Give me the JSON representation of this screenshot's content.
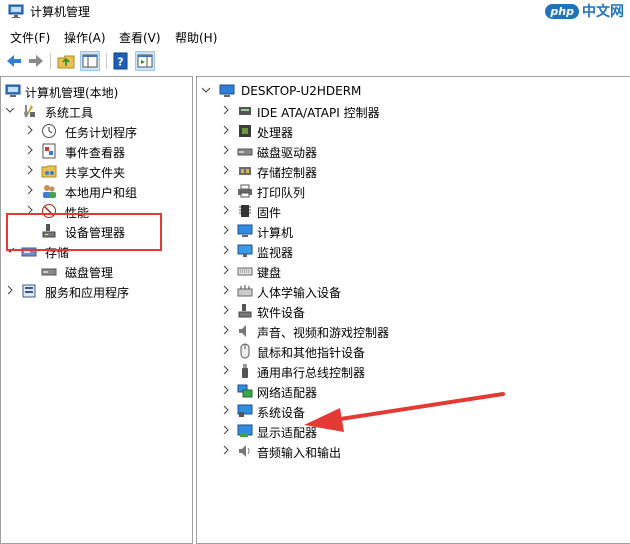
{
  "window": {
    "title": "计算机管理"
  },
  "watermark": {
    "brand": "php",
    "text": "中文网"
  },
  "menu": [
    "文件(F)",
    "操作(A)",
    "查看(V)",
    "帮助(H)"
  ],
  "left_tree": [
    {
      "label": "计算机管理(本地)",
      "icon": "computer-management-icon"
    },
    {
      "label": "系统工具",
      "icon": "system-tools-icon"
    },
    {
      "label": "任务计划程序",
      "icon": "clock-icon"
    },
    {
      "label": "事件查看器",
      "icon": "event-viewer-icon"
    },
    {
      "label": "共享文件夹",
      "icon": "shared-folder-icon"
    },
    {
      "label": "本地用户和组",
      "icon": "users-icon"
    },
    {
      "label": "性能",
      "icon": "performance-icon"
    },
    {
      "label": "设备管理器",
      "icon": "device-manager-icon"
    },
    {
      "label": "存储",
      "icon": "storage-icon"
    },
    {
      "label": "磁盘管理",
      "icon": "disk-management-icon"
    },
    {
      "label": "服务和应用程序",
      "icon": "services-icon"
    }
  ],
  "device_tree": {
    "root": "DESKTOP-U2HDERM",
    "items": [
      {
        "label": "IDE ATA/ATAPI 控制器",
        "icon": "ide-controller-icon"
      },
      {
        "label": "处理器",
        "icon": "processor-icon"
      },
      {
        "label": "磁盘驱动器",
        "icon": "disk-drive-icon"
      },
      {
        "label": "存储控制器",
        "icon": "storage-controller-icon"
      },
      {
        "label": "打印队列",
        "icon": "printer-icon"
      },
      {
        "label": "固件",
        "icon": "firmware-icon"
      },
      {
        "label": "计算机",
        "icon": "computer-icon"
      },
      {
        "label": "监视器",
        "icon": "monitor-icon"
      },
      {
        "label": "键盘",
        "icon": "keyboard-icon"
      },
      {
        "label": "人体学输入设备",
        "icon": "hid-icon"
      },
      {
        "label": "软件设备",
        "icon": "software-device-icon"
      },
      {
        "label": "声音、视频和游戏控制器",
        "icon": "speaker-icon"
      },
      {
        "label": "鼠标和其他指针设备",
        "icon": "mouse-icon"
      },
      {
        "label": "通用串行总线控制器",
        "icon": "usb-icon"
      },
      {
        "label": "网络适配器",
        "icon": "network-adapter-icon"
      },
      {
        "label": "系统设备",
        "icon": "system-device-icon"
      },
      {
        "label": "显示适配器",
        "icon": "display-adapter-icon"
      },
      {
        "label": "音频输入和输出",
        "icon": "audio-io-icon"
      }
    ]
  },
  "colors": {
    "highlight": "#e53935",
    "accent": "#1e73be"
  }
}
